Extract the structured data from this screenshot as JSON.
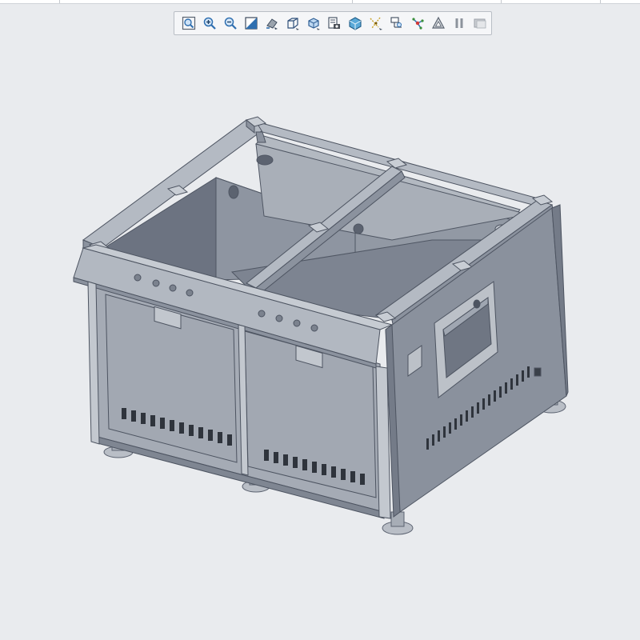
{
  "app": {
    "viewport_background": "#e9ebee",
    "model_color": "#a5abb5"
  },
  "toolbar": {
    "buttons": [
      {
        "name": "refit-icon"
      },
      {
        "name": "zoom-in-icon"
      },
      {
        "name": "zoom-out-icon"
      },
      {
        "name": "repaint-icon"
      },
      {
        "name": "reorient-icon"
      },
      {
        "name": "saved-orientations-icon"
      },
      {
        "name": "display-style-icon"
      },
      {
        "name": "view-manager-icon"
      },
      {
        "name": "perspective-view-icon"
      },
      {
        "name": "datum-display-icon"
      },
      {
        "name": "annotation-display-icon"
      },
      {
        "name": "spin-center-icon"
      },
      {
        "name": "simulation-icon"
      },
      {
        "name": "pause-icon"
      },
      {
        "name": "stop-icon"
      }
    ]
  }
}
